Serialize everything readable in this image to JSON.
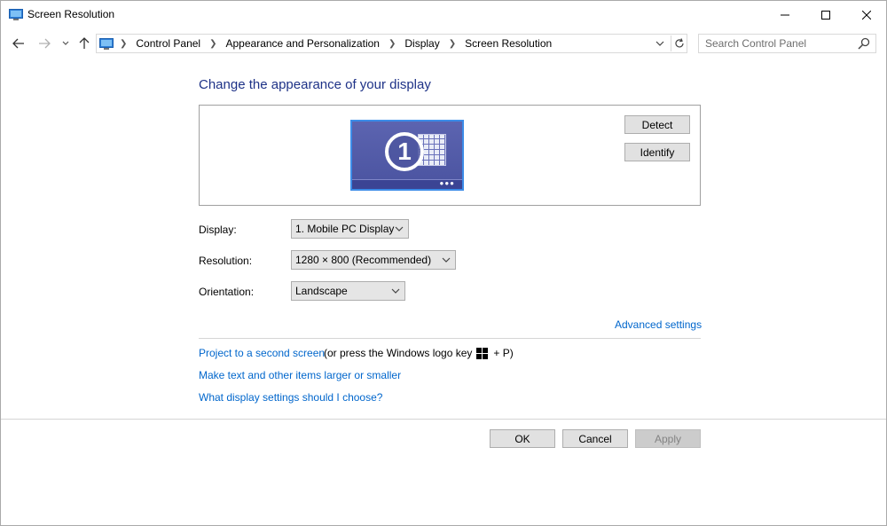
{
  "window": {
    "title": "Screen Resolution"
  },
  "address": {
    "crumbs": [
      "Control Panel",
      "Appearance and Personalization",
      "Display",
      "Screen Resolution"
    ]
  },
  "search": {
    "placeholder": "Search Control Panel"
  },
  "main": {
    "heading": "Change the appearance of your display",
    "detect_label": "Detect",
    "identify_label": "Identify",
    "monitor_number": "1",
    "display_label": "Display:",
    "display_value": "1. Mobile PC Display",
    "resolution_label": "Resolution:",
    "resolution_value": "1280 × 800 (Recommended)",
    "orientation_label": "Orientation:",
    "orientation_value": "Landscape",
    "advanced_link": "Advanced settings",
    "project_link": "Project to a second screen",
    "project_hint_pre": "(or press the Windows logo key",
    "project_hint_post": "+ P)",
    "text_size_link": "Make text and other items larger or smaller",
    "help_link": "What display settings should I choose?"
  },
  "footer": {
    "ok_label": "OK",
    "cancel_label": "Cancel",
    "apply_label": "Apply"
  },
  "colors": {
    "heading": "#1e3287",
    "link": "#0066cc",
    "monitor_border": "#3c8ce8"
  },
  "icons": [
    "display-app-icon",
    "back-arrow-icon",
    "forward-arrow-icon",
    "recent-pages-chevron-icon",
    "up-arrow-icon",
    "chevron-right-icon",
    "dropdown-chevron-icon",
    "refresh-icon",
    "search-icon",
    "windows-logo-icon"
  ]
}
